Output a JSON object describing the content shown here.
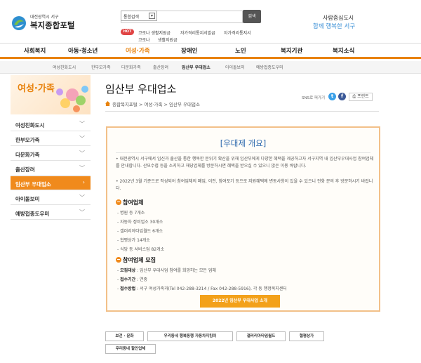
{
  "header": {
    "logo_small": "대전광역시 서구",
    "logo_big": "복지종합포털",
    "search_select": "통합검색",
    "search_button": "검색",
    "hot_badge": "HOT",
    "keywords_line1": [
      "코로나 생활지원금",
      "자가격리통지서발급",
      "자가격리통지서"
    ],
    "keywords_line2": [
      "코로나",
      "생활지원금"
    ],
    "slogan1": "사람중심도시",
    "slogan2": "함께 행복한 서구"
  },
  "nav": [
    "사회복지",
    "아동·청소년",
    "여성·가족",
    "장애인",
    "노인",
    "복지기관",
    "복지소식"
  ],
  "nav_active": "여성·가족",
  "subnav": [
    "여성친화도시",
    "한부모가족",
    "다문화가족",
    "출산장려",
    "임산부 우대업소",
    "아이돌보미",
    "예방접종도우미"
  ],
  "sidebar": {
    "title": "여성·가족",
    "items": [
      "여성친화도시",
      "한부모가족",
      "다문화가족",
      "출산장려",
      "임산부 우대업소",
      "아이돌보미",
      "예방접종도우미"
    ]
  },
  "content": {
    "page_title": "임산부 우대업소",
    "breadcrumb": "종합복지포털 > 여성·가족 > 임산부 우대업소",
    "sns_label": "SNS로 퍼가기",
    "print_label": "프린트"
  },
  "box": {
    "heading": "[우대제 개요]",
    "para1": "• 대전광역시 서구에서 임신과 출산을 통한 행복한 분위기 확산을 위해 임산부에게 다양한 혜택을 제공하고자 서구지역 내 임산부우대사업 참여업체를 안내합니다. 산모수첩 등을 소지하고 해당업체를 방문하시면 혜택을 받으실 수 있으니 많은 이용 바랍니다.",
    "para2": "• 2022년 3월 기준으로 작성되어 참여업체의 폐업, 이전, 참여포기 등으로 지원혜택에 변동사항이 있을 수 있으니 전화 문의 후 방문하시기 바랍니다.",
    "sec1": "참여업체",
    "sec1_items": [
      "병원 등 7개소",
      "자동차 정비업소 30개소",
      "갤러리아타임월드 6개소",
      "협평상가 14개소",
      "식당 등 서비스업 82개소"
    ],
    "sec2": "참여업체 모집",
    "sec2_items": [
      {
        "label": "모집대상",
        "text": " : 임산부 우대사업 참여를 희망하는 모든 업체"
      },
      {
        "label": "접수기간",
        "text": " : 연중"
      },
      {
        "label": "접수방법",
        "text": " : 서구 여성가족과(Tel 042-288-3214 / Fax 042-288-5916), 각 동 행정복지센터"
      }
    ],
    "cta": "2022년 임산부 우대사업 소개"
  },
  "tabs": [
    "보건 · 문화",
    "우리동네 행복동행 자동차지킴이",
    "갤러리아타임월드",
    "협평상가",
    "우리동네 할인업체"
  ],
  "colors": {
    "accent": "#e8820c",
    "heading_blue": "#2a67ad",
    "cta": "#f3a11a"
  }
}
